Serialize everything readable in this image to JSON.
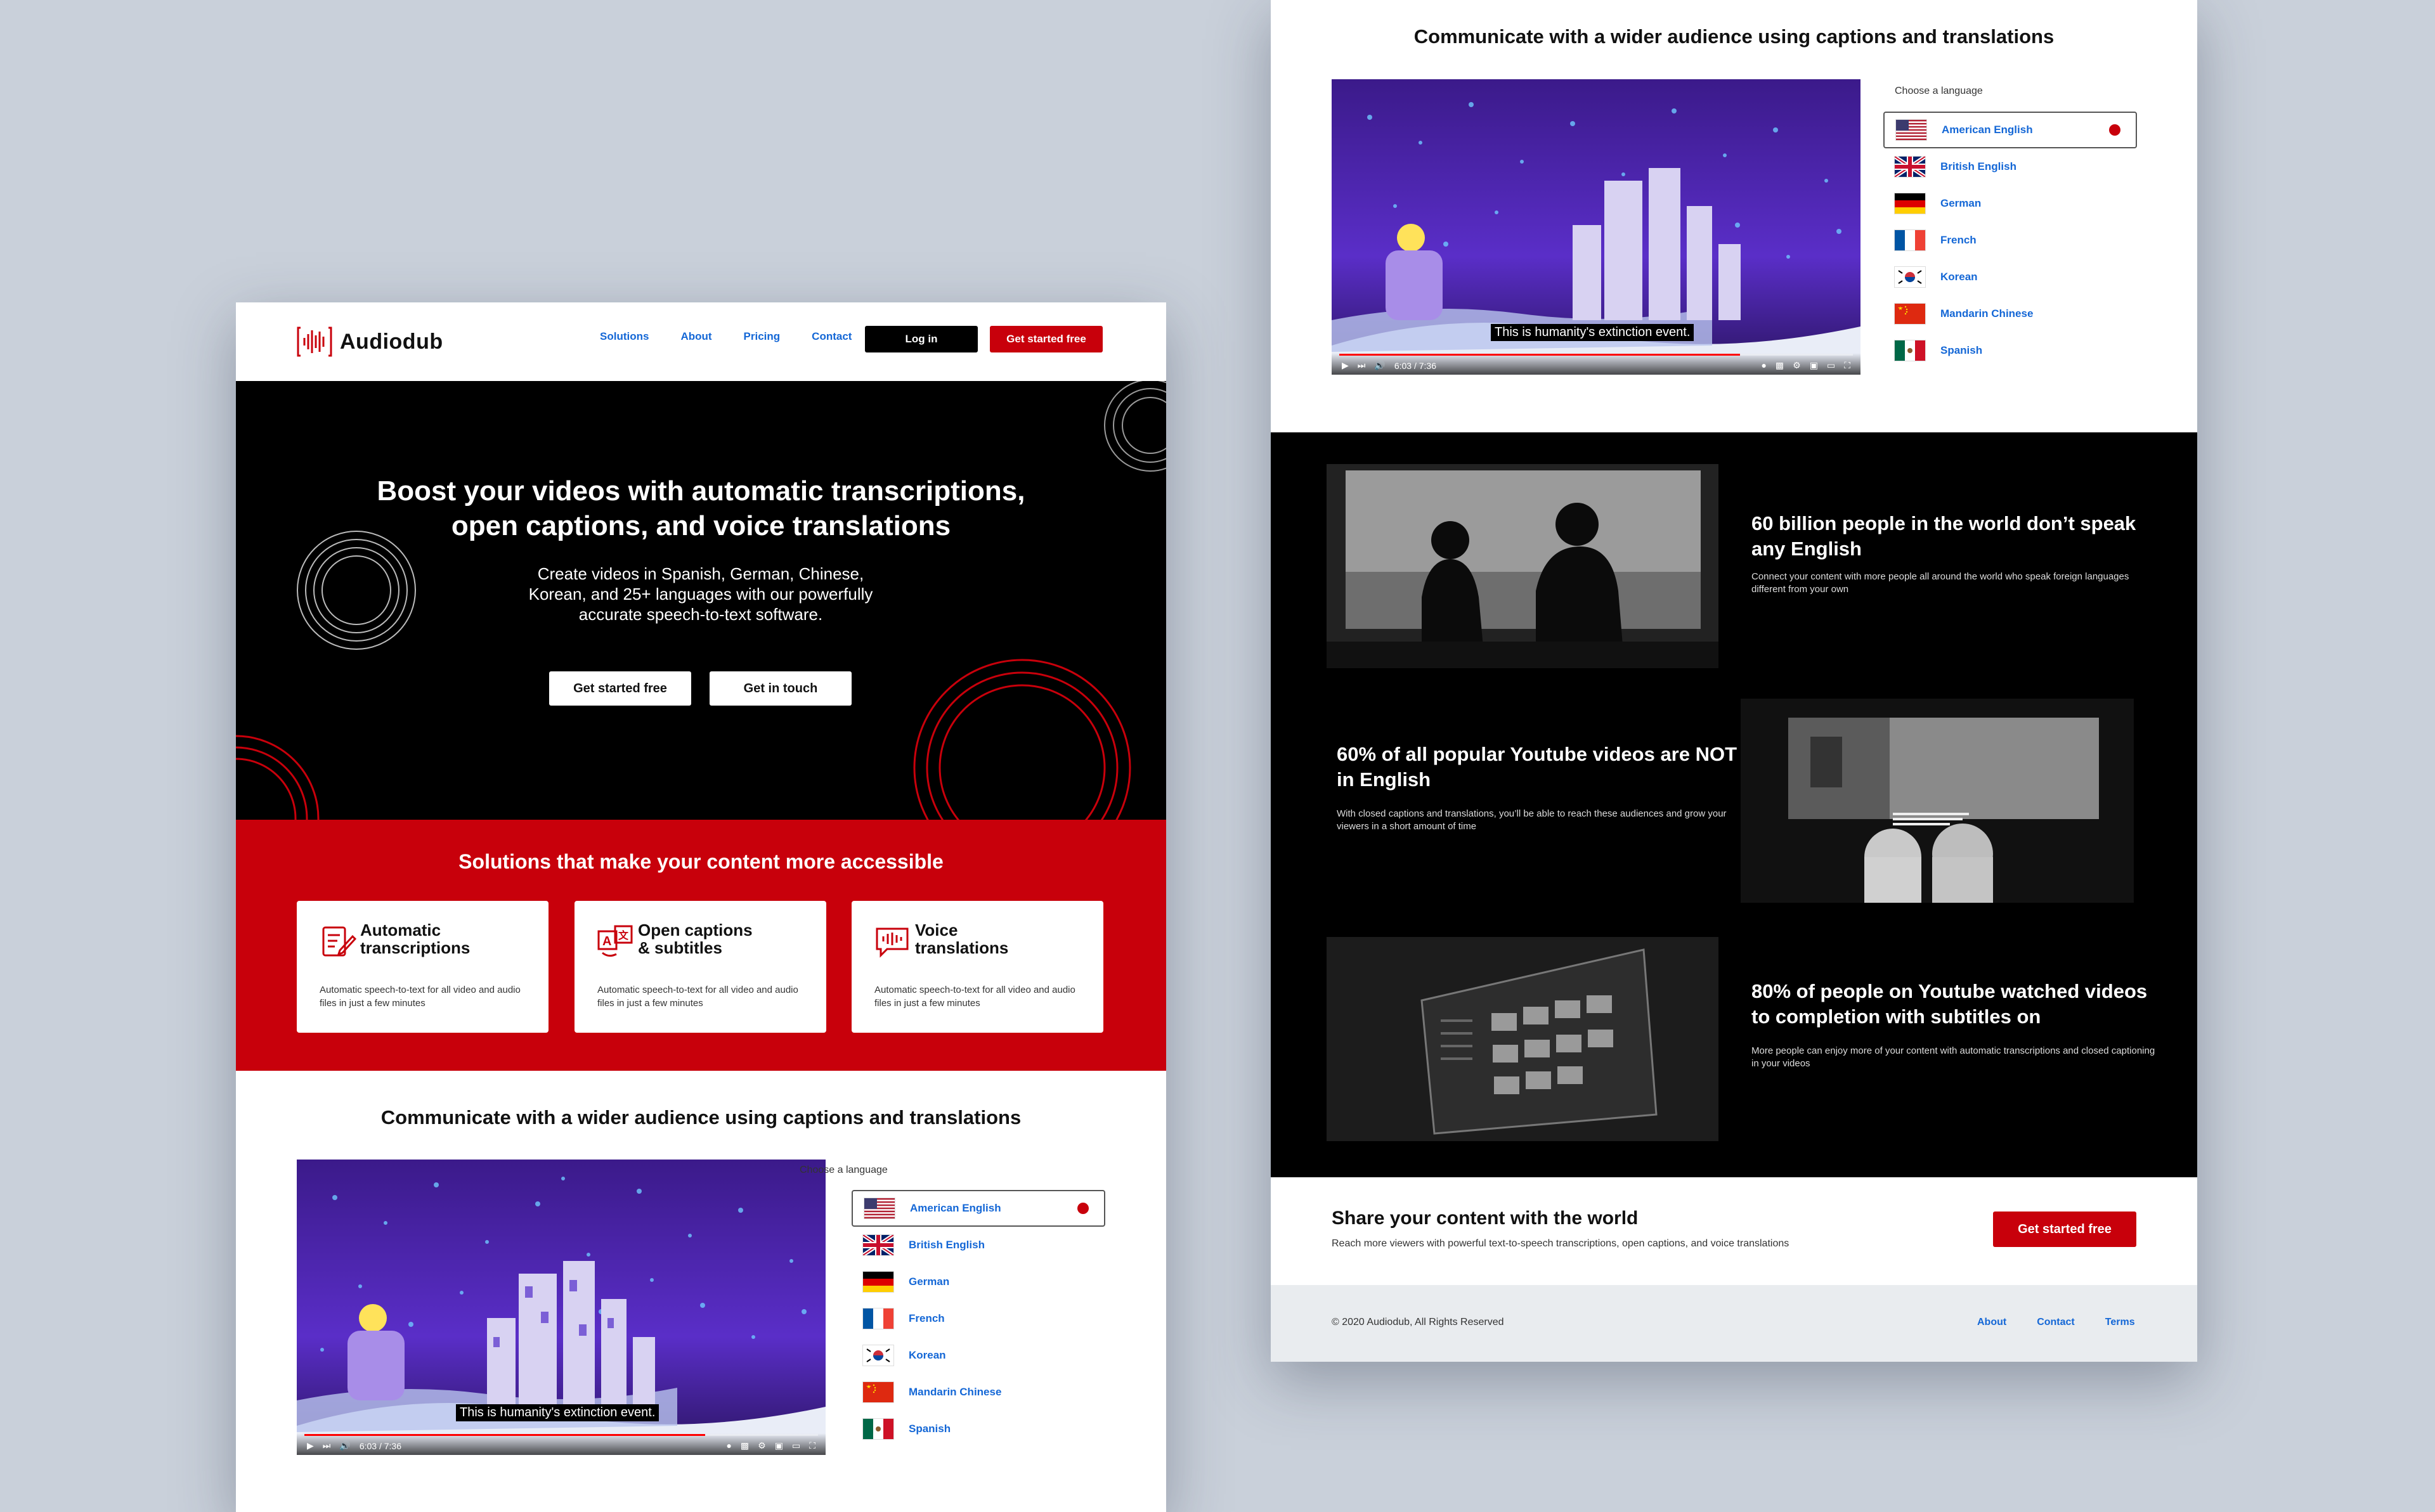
{
  "brand": {
    "name": "Audiodub"
  },
  "nav": {
    "solutions": "Solutions",
    "about": "About",
    "pricing": "Pricing",
    "contact": "Contact",
    "login": "Log in",
    "get_started": "Get started free"
  },
  "hero": {
    "title_line1": "Boost your videos with automatic transcriptions,",
    "title_line2": "open captions, and voice translations",
    "subtitle": "Create videos in Spanish, German, Chinese, Korean, and 25+ languages with our powerfully accurate speech-to-text software.",
    "cta_primary": "Get started free",
    "cta_secondary": "Get in touch"
  },
  "solutions": {
    "title": "Solutions that make your content more accessible",
    "cards": [
      {
        "title_line1": "Automatic",
        "title_line2": "transcriptions",
        "desc": "Automatic speech-to-text for all video and audio files in just a few minutes",
        "icon": "document-pen-icon"
      },
      {
        "title_line1": "Open captions",
        "title_line2": "& subtitles",
        "desc": "Automatic speech-to-text for all video and audio files in just a few minutes",
        "icon": "translate-icon"
      },
      {
        "title_line1": "Voice",
        "title_line2": "translations",
        "desc": "Automatic speech-to-text for all video and audio files in just a few minutes",
        "icon": "speech-wave-icon"
      }
    ]
  },
  "communicate": {
    "title": "Communicate with a wider audience using captions and translations",
    "caption": "This is humanity's extinction event.",
    "time": "6:03 / 7:36",
    "progress": 0.78,
    "choose_label": "Choose a language",
    "languages": [
      "American English",
      "British English",
      "German",
      "French",
      "Korean",
      "Mandarin Chinese",
      "Spanish"
    ],
    "selected": "American English"
  },
  "stats": [
    {
      "title": "60 billion people in the world don’t speak any English",
      "desc": "Connect your content with more people all around the world who speak foreign languages different from your own"
    },
    {
      "title": "60% of all popular Youtube videos are NOT in English",
      "desc": "With closed captions and translations, you’ll be able to reach these audiences and grow your viewers in a short amount of time"
    },
    {
      "title": "80% of people on Youtube watched videos to completion with subtitles on",
      "desc": "More people can enjoy more of your content with automatic transcriptions and closed captioning in your videos"
    }
  ],
  "share": {
    "title": "Share your content with the world",
    "desc": "Reach more viewers with powerful text-to-speech transcriptions, open captions, and voice translations",
    "cta": "Get started free"
  },
  "footer": {
    "copyright": "©  2020 Audiodub, All Rights Reserved",
    "about": "About",
    "contact": "Contact",
    "terms": "Terms"
  },
  "colors": {
    "brand_red": "#c8000b",
    "link_blue": "#1467d6",
    "hero_black": "#000000"
  }
}
